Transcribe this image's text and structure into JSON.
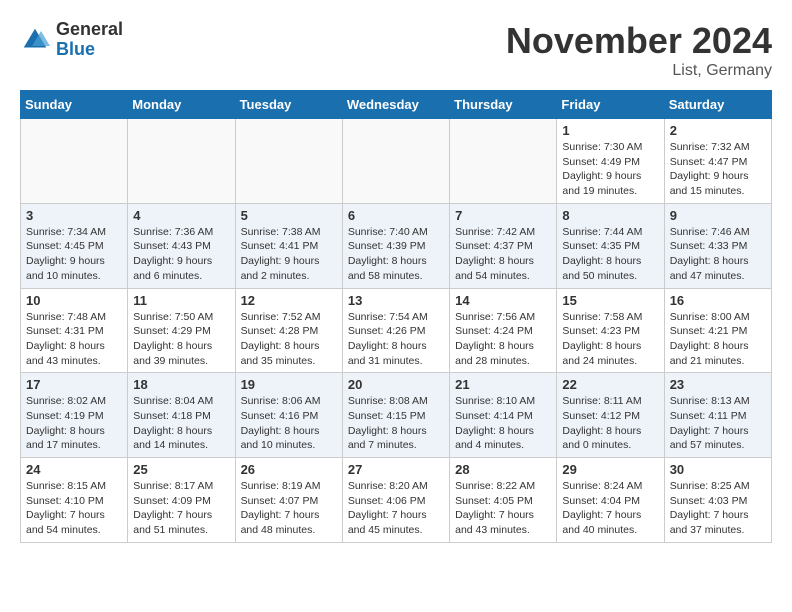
{
  "header": {
    "logo_general": "General",
    "logo_blue": "Blue",
    "month_title": "November 2024",
    "location": "List, Germany"
  },
  "weekdays": [
    "Sunday",
    "Monday",
    "Tuesday",
    "Wednesday",
    "Thursday",
    "Friday",
    "Saturday"
  ],
  "weeks": [
    [
      {
        "day": "",
        "info": ""
      },
      {
        "day": "",
        "info": ""
      },
      {
        "day": "",
        "info": ""
      },
      {
        "day": "",
        "info": ""
      },
      {
        "day": "",
        "info": ""
      },
      {
        "day": "1",
        "info": "Sunrise: 7:30 AM\nSunset: 4:49 PM\nDaylight: 9 hours\nand 19 minutes."
      },
      {
        "day": "2",
        "info": "Sunrise: 7:32 AM\nSunset: 4:47 PM\nDaylight: 9 hours\nand 15 minutes."
      }
    ],
    [
      {
        "day": "3",
        "info": "Sunrise: 7:34 AM\nSunset: 4:45 PM\nDaylight: 9 hours\nand 10 minutes."
      },
      {
        "day": "4",
        "info": "Sunrise: 7:36 AM\nSunset: 4:43 PM\nDaylight: 9 hours\nand 6 minutes."
      },
      {
        "day": "5",
        "info": "Sunrise: 7:38 AM\nSunset: 4:41 PM\nDaylight: 9 hours\nand 2 minutes."
      },
      {
        "day": "6",
        "info": "Sunrise: 7:40 AM\nSunset: 4:39 PM\nDaylight: 8 hours\nand 58 minutes."
      },
      {
        "day": "7",
        "info": "Sunrise: 7:42 AM\nSunset: 4:37 PM\nDaylight: 8 hours\nand 54 minutes."
      },
      {
        "day": "8",
        "info": "Sunrise: 7:44 AM\nSunset: 4:35 PM\nDaylight: 8 hours\nand 50 minutes."
      },
      {
        "day": "9",
        "info": "Sunrise: 7:46 AM\nSunset: 4:33 PM\nDaylight: 8 hours\nand 47 minutes."
      }
    ],
    [
      {
        "day": "10",
        "info": "Sunrise: 7:48 AM\nSunset: 4:31 PM\nDaylight: 8 hours\nand 43 minutes."
      },
      {
        "day": "11",
        "info": "Sunrise: 7:50 AM\nSunset: 4:29 PM\nDaylight: 8 hours\nand 39 minutes."
      },
      {
        "day": "12",
        "info": "Sunrise: 7:52 AM\nSunset: 4:28 PM\nDaylight: 8 hours\nand 35 minutes."
      },
      {
        "day": "13",
        "info": "Sunrise: 7:54 AM\nSunset: 4:26 PM\nDaylight: 8 hours\nand 31 minutes."
      },
      {
        "day": "14",
        "info": "Sunrise: 7:56 AM\nSunset: 4:24 PM\nDaylight: 8 hours\nand 28 minutes."
      },
      {
        "day": "15",
        "info": "Sunrise: 7:58 AM\nSunset: 4:23 PM\nDaylight: 8 hours\nand 24 minutes."
      },
      {
        "day": "16",
        "info": "Sunrise: 8:00 AM\nSunset: 4:21 PM\nDaylight: 8 hours\nand 21 minutes."
      }
    ],
    [
      {
        "day": "17",
        "info": "Sunrise: 8:02 AM\nSunset: 4:19 PM\nDaylight: 8 hours\nand 17 minutes."
      },
      {
        "day": "18",
        "info": "Sunrise: 8:04 AM\nSunset: 4:18 PM\nDaylight: 8 hours\nand 14 minutes."
      },
      {
        "day": "19",
        "info": "Sunrise: 8:06 AM\nSunset: 4:16 PM\nDaylight: 8 hours\nand 10 minutes."
      },
      {
        "day": "20",
        "info": "Sunrise: 8:08 AM\nSunset: 4:15 PM\nDaylight: 8 hours\nand 7 minutes."
      },
      {
        "day": "21",
        "info": "Sunrise: 8:10 AM\nSunset: 4:14 PM\nDaylight: 8 hours\nand 4 minutes."
      },
      {
        "day": "22",
        "info": "Sunrise: 8:11 AM\nSunset: 4:12 PM\nDaylight: 8 hours\nand 0 minutes."
      },
      {
        "day": "23",
        "info": "Sunrise: 8:13 AM\nSunset: 4:11 PM\nDaylight: 7 hours\nand 57 minutes."
      }
    ],
    [
      {
        "day": "24",
        "info": "Sunrise: 8:15 AM\nSunset: 4:10 PM\nDaylight: 7 hours\nand 54 minutes."
      },
      {
        "day": "25",
        "info": "Sunrise: 8:17 AM\nSunset: 4:09 PM\nDaylight: 7 hours\nand 51 minutes."
      },
      {
        "day": "26",
        "info": "Sunrise: 8:19 AM\nSunset: 4:07 PM\nDaylight: 7 hours\nand 48 minutes."
      },
      {
        "day": "27",
        "info": "Sunrise: 8:20 AM\nSunset: 4:06 PM\nDaylight: 7 hours\nand 45 minutes."
      },
      {
        "day": "28",
        "info": "Sunrise: 8:22 AM\nSunset: 4:05 PM\nDaylight: 7 hours\nand 43 minutes."
      },
      {
        "day": "29",
        "info": "Sunrise: 8:24 AM\nSunset: 4:04 PM\nDaylight: 7 hours\nand 40 minutes."
      },
      {
        "day": "30",
        "info": "Sunrise: 8:25 AM\nSunset: 4:03 PM\nDaylight: 7 hours\nand 37 minutes."
      }
    ]
  ]
}
